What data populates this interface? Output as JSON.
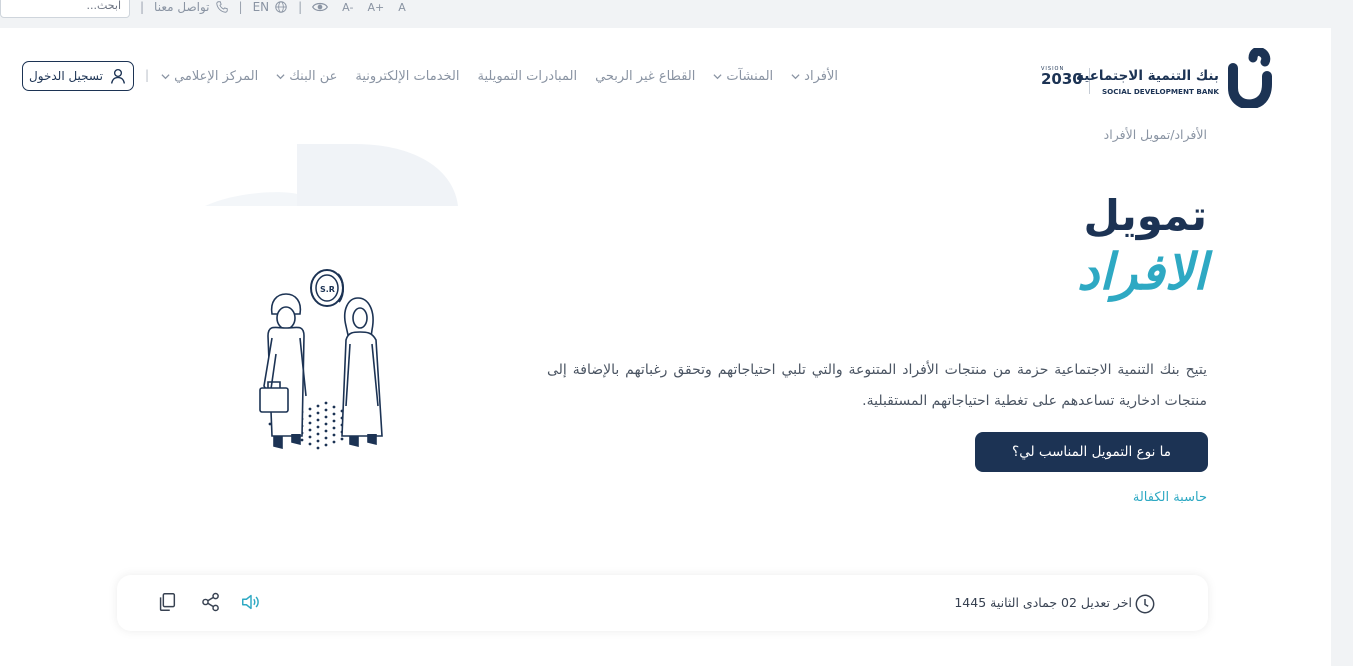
{
  "topbar": {
    "search_placeholder": "ابحث...",
    "contact_label": "تواصل معنا",
    "lang_label": "EN",
    "font_sizes": [
      "A-",
      "A+",
      "A"
    ]
  },
  "header": {
    "logo_ar": "بنك التنمية الاجتماعية",
    "logo_en": "SOCIAL DEVELOPMENT BANK",
    "vision_label": "VISION",
    "vision_year": "2030",
    "nav": [
      {
        "label": "الأفراد",
        "dropdown": true
      },
      {
        "label": "المنشآت",
        "dropdown": true
      },
      {
        "label": "القطاع غير الربحي",
        "dropdown": false
      },
      {
        "label": "المبادرات التمويلية",
        "dropdown": false
      },
      {
        "label": "الخدمات الإلكترونية",
        "dropdown": false
      },
      {
        "label": "عن البنك",
        "dropdown": true
      },
      {
        "label": "المركز الإعلامي",
        "dropdown": true
      }
    ],
    "nav_separator": "|",
    "login_label": "تسجيل الدخول"
  },
  "breadcrumb": "الأفراد/تمويل الأفراد",
  "hero": {
    "title_line1": "تمويل",
    "title_line2": "الافراد",
    "coin_label": "S.R",
    "description": "يتيح بنك التنمية الاجتماعية حزمة من منتجات الأفراد المتنوعة والتي تلبي احتياجاتهم وتحقق رغباتهم بالإضافة إلى منتجات ادخارية تساعدهم على تغطية احتياجاتهم المستقبلية.",
    "cta_label": "ما نوع التمويل المناسب لي؟",
    "calc_link": "حاسبة الكفالة"
  },
  "footer": {
    "last_modified": "اخر تعديل 02 جمادى الثانية 1445"
  },
  "colors": {
    "navy": "#1c3354",
    "teal": "#2ea9c3",
    "muted": "#8a94a3"
  },
  "icons": [
    "phone-icon",
    "globe-icon",
    "eye-icon",
    "user-icon",
    "clock-icon",
    "copy-icon",
    "share-icon",
    "speaker-icon"
  ]
}
